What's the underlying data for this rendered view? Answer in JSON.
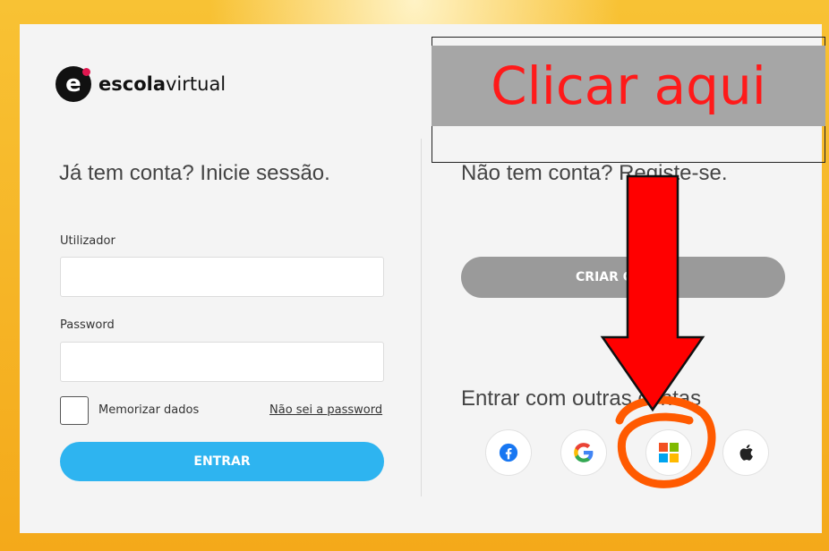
{
  "brand": {
    "mark": "e",
    "name_bold": "escola",
    "name_rest": "virtual"
  },
  "login": {
    "title": "Já tem conta? Inicie sessão.",
    "username_label": "Utilizador",
    "username_value": "",
    "password_label": "Password",
    "password_value": "",
    "remember_label": "Memorizar dados",
    "remember_checked": false,
    "forgot_link": "Não sei a password",
    "submit_label": "ENTRAR"
  },
  "register": {
    "title": "Não tem conta? Registe-se.",
    "create_label": "CRIAR CONTA"
  },
  "other_accounts": {
    "title": "Entrar com outras contas",
    "providers": [
      "facebook-icon",
      "google-icon",
      "microsoft-icon",
      "apple-icon"
    ]
  },
  "annotation": {
    "callout_text": "Clicar aqui",
    "callout_text_color": "#ff1a1a",
    "arrow_color": "#ff0000",
    "highlight_color": "#ff5a00"
  },
  "colors": {
    "primary": "#2eb4f0",
    "secondary": "#9a9a9a",
    "background": "#f5b81c"
  }
}
